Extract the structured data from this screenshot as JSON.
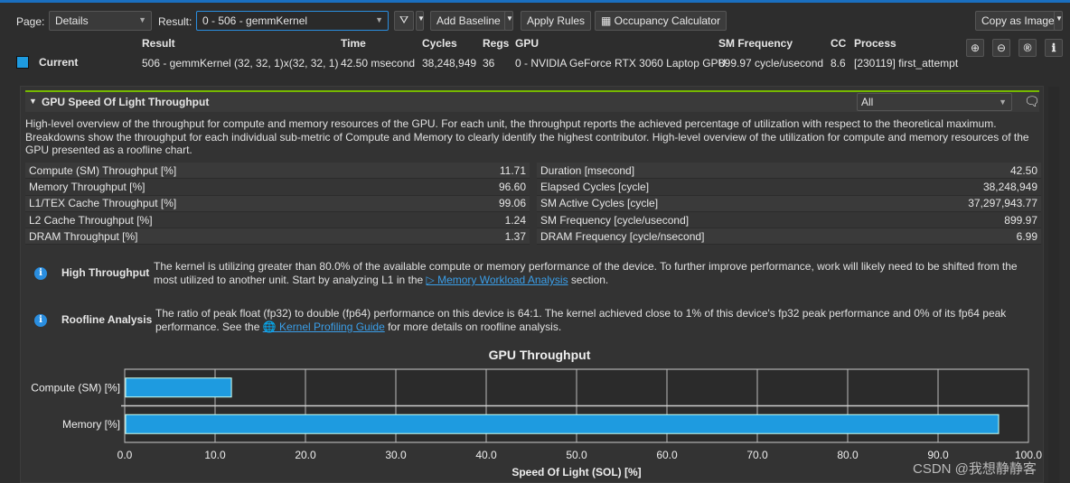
{
  "toolbar": {
    "page_label": "Page:",
    "page_value": "Details",
    "result_label": "Result:",
    "result_value": "0 -   506 - gemmKernel",
    "add_baseline": "Add Baseline",
    "apply_rules": "Apply Rules",
    "occupancy": "Occupancy Calculator",
    "copy_image": "Copy as Image"
  },
  "results": {
    "headers": {
      "result": "Result",
      "time": "Time",
      "cycles": "Cycles",
      "regs": "Regs",
      "gpu": "GPU",
      "smfreq": "SM Frequency",
      "cc": "CC",
      "process": "Process"
    },
    "current": {
      "label": "Current",
      "result": "506 - gemmKernel (32, 32, 1)x(32, 32, 1)",
      "time": "42.50 msecond",
      "cycles": "38,248,949",
      "regs": "36",
      "gpu": "0 - NVIDIA GeForce RTX 3060 Laptop GPU",
      "smfreq": "899.97 cycle/usecond",
      "cc": "8.6",
      "process": "[230119] first_attempt"
    },
    "color": "#1e9be0"
  },
  "section": {
    "title": "GPU Speed Of Light Throughput",
    "filter": "All",
    "description": "High-level overview of the throughput for compute and memory resources of the GPU. For each unit, the throughput reports the achieved percentage of utilization with respect to the theoretical maximum. Breakdowns show the throughput for each individual sub-metric of Compute and Memory to clearly identify the highest contributor. High-level overview of the utilization for compute and memory resources of the GPU presented as a roofline chart.",
    "left": [
      {
        "k": "Compute (SM) Throughput [%]",
        "v": "11.71"
      },
      {
        "k": "Memory Throughput [%]",
        "v": "96.60"
      },
      {
        "k": "L1/TEX Cache Throughput [%]",
        "v": "99.06"
      },
      {
        "k": "L2 Cache Throughput [%]",
        "v": "1.24"
      },
      {
        "k": "DRAM Throughput [%]",
        "v": "1.37"
      }
    ],
    "right": [
      {
        "k": "Duration [msecond]",
        "v": "42.50"
      },
      {
        "k": "Elapsed Cycles [cycle]",
        "v": "38,248,949"
      },
      {
        "k": "SM Active Cycles [cycle]",
        "v": "37,297,943.77"
      },
      {
        "k": "SM Frequency [cycle/usecond]",
        "v": "899.97"
      },
      {
        "k": "DRAM Frequency [cycle/nsecond]",
        "v": "6.99"
      }
    ]
  },
  "rules": [
    {
      "title": "High Throughput",
      "text1": "The kernel is utilizing greater than 80.0% of the available compute or memory performance of the device. To further improve performance, work will likely need to be shifted from the most utilized to another unit. Start by analyzing L1 in the ",
      "link": "▷ Memory Workload Analysis",
      "text2": " section."
    },
    {
      "title": "Roofline Analysis",
      "text1": "The ratio of peak float (fp32) to double (fp64) performance on this device is 64:1. The kernel achieved close to 1% of this device's fp32 peak performance and 0% of its fp64 peak performance. See the ",
      "link": "🌐 Kernel Profiling Guide",
      "text2": " for more details on roofline analysis."
    }
  ],
  "chart_data": {
    "type": "bar",
    "orientation": "horizontal",
    "title": "GPU Throughput",
    "xlabel": "Speed Of Light (SOL) [%]",
    "categories": [
      "Compute (SM) [%]",
      "Memory [%]"
    ],
    "values": [
      11.71,
      96.6
    ],
    "xlim": [
      0,
      100
    ],
    "ticks": [
      "0.0",
      "10.0",
      "20.0",
      "30.0",
      "40.0",
      "50.0",
      "60.0",
      "70.0",
      "80.0",
      "90.0",
      "100.0"
    ],
    "grid": true,
    "color": "#1e9be0"
  },
  "watermark": "CSDN @我想静静客"
}
